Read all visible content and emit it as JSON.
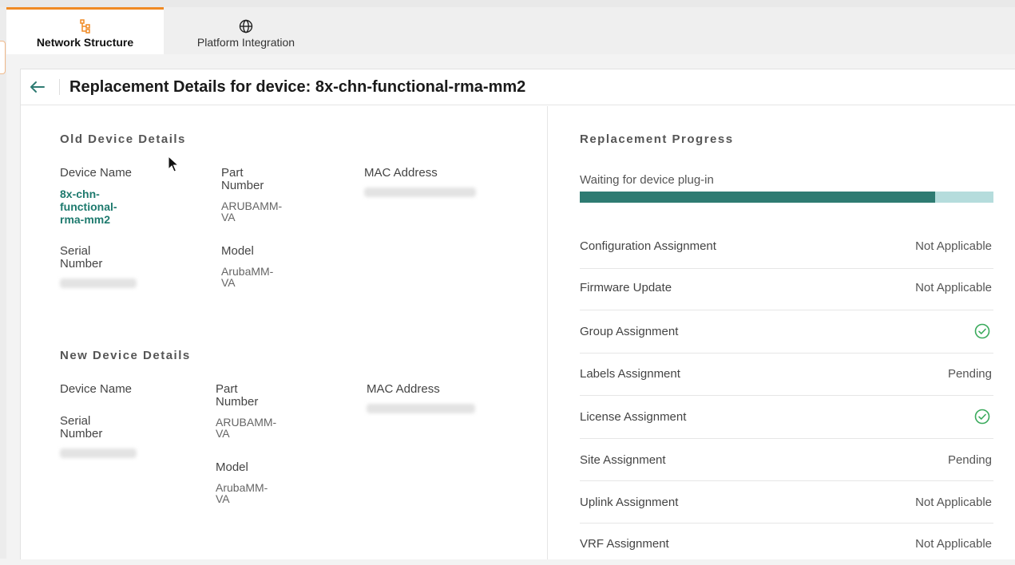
{
  "tabs": [
    {
      "label": "Network Structure",
      "icon": "network-structure-icon",
      "active": true
    },
    {
      "label": "Platform Integration",
      "icon": "globe-icon",
      "active": false
    }
  ],
  "header": {
    "back_icon": "back-arrow-icon",
    "title": "Replacement Details for device: 8x-chn-functional-rma-mm2"
  },
  "old_device": {
    "heading": "Old Device Details",
    "device_name_label": "Device Name",
    "device_name_value": [
      "8x-chn-",
      "functional-",
      "rma-mm2"
    ],
    "part_number_label": [
      "Part",
      "Number"
    ],
    "part_number_value": [
      "ARUBAMM-",
      "VA"
    ],
    "mac_label": "MAC Address",
    "serial_label": [
      "Serial",
      "Number"
    ],
    "model_label": "Model",
    "model_value": [
      "ArubaMM-",
      "VA"
    ]
  },
  "new_device": {
    "heading": "New Device Details",
    "device_name_label": "Device Name",
    "part_number_label": [
      "Part",
      "Number"
    ],
    "part_number_value": [
      "ARUBAMM-",
      "VA"
    ],
    "mac_label": "MAC Address",
    "serial_label": [
      "Serial",
      "Number"
    ],
    "model_label": "Model",
    "model_value": [
      "ArubaMM-",
      "VA"
    ]
  },
  "progress": {
    "heading": "Replacement Progress",
    "status": "Waiting for device plug-in",
    "percent": 86,
    "colors": {
      "fill": "#2e7b72",
      "track": "#b5dcdc",
      "check": "#3aaa5c",
      "link": "#1e7a6e",
      "active_tab": "#f08a24"
    },
    "rows": [
      {
        "label": "Configuration Assignment",
        "value": "Not Applicable"
      },
      {
        "label": "Firmware Update",
        "value": "Not Applicable"
      },
      {
        "label": "Group Assignment",
        "value": "",
        "icon": "check-circle-icon"
      },
      {
        "label": "Labels Assignment",
        "value": "Pending"
      },
      {
        "label": "License Assignment",
        "value": "",
        "icon": "check-circle-icon"
      },
      {
        "label": "Site Assignment",
        "value": "Pending"
      },
      {
        "label": "Uplink Assignment",
        "value": "Not Applicable"
      },
      {
        "label": "VRF Assignment",
        "value": "Not Applicable"
      }
    ]
  }
}
